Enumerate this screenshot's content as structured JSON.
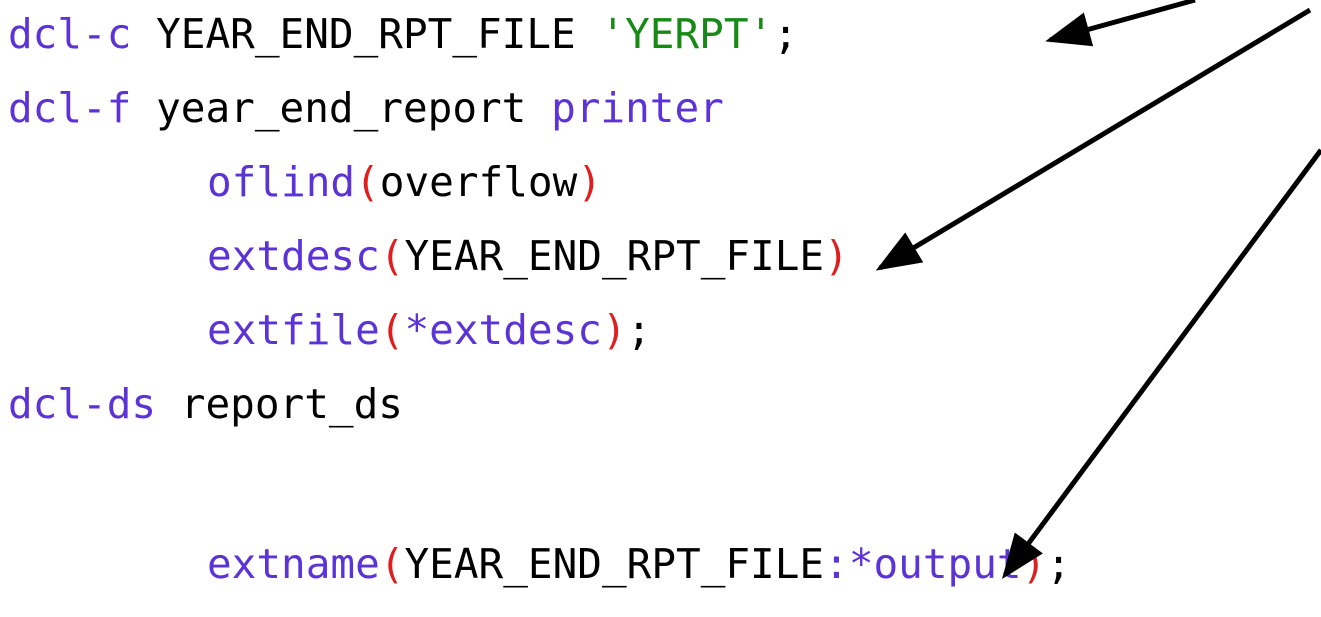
{
  "lines": [
    {
      "parts": [
        "dcl-c",
        " ",
        "YEAR_END_RPT_FILE",
        " ",
        "'YERPT'",
        ";"
      ]
    },
    {
      "parts": [
        "dcl-f",
        " ",
        "year_end_report",
        " ",
        "printer"
      ]
    },
    {
      "parts": [
        "oflind",
        "(",
        "overflow",
        ")"
      ]
    },
    {
      "parts": [
        "extdesc",
        "(",
        "YEAR_END_RPT_FILE",
        ")"
      ]
    },
    {
      "parts": [
        "extfile",
        "(",
        "*extdesc",
        ")",
        ";"
      ]
    },
    {
      "parts": [
        "dcl-ds",
        " ",
        "report_ds"
      ]
    },
    {
      "parts": [
        "extname",
        "(",
        "YEAR_END_RPT_FILE",
        ":",
        "*output",
        ")",
        ";"
      ]
    }
  ],
  "colors": {
    "keyword": "#5b33d6",
    "string": "#168a14",
    "paren": "#e01e1e",
    "plain": "#000000",
    "arrow": "#000000"
  }
}
